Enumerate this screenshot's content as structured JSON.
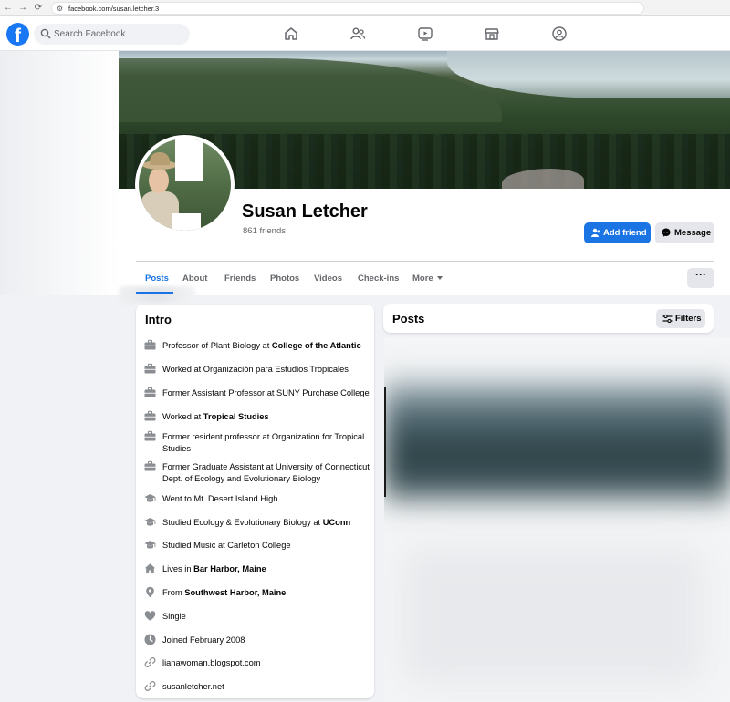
{
  "browser": {
    "back": "←",
    "forward": "→",
    "reload": "⟳",
    "site_settings": "⚙",
    "url": "facebook.com/susan.letcher.3"
  },
  "header": {
    "logo": "f",
    "search_placeholder": "Search Facebook"
  },
  "profile": {
    "name": "Susan Letcher",
    "friends": "861 friends",
    "add_friend_label": "Add friend",
    "message_label": "Message",
    "more_options_label": "···"
  },
  "tabs": [
    {
      "label": "Posts"
    },
    {
      "label": "About"
    },
    {
      "label": "Friends"
    },
    {
      "label": "Photos"
    },
    {
      "label": "Videos"
    },
    {
      "label": "Check-ins"
    },
    {
      "label": "More"
    }
  ],
  "intro": {
    "title": "Intro",
    "items": [
      {
        "icon": "briefcase-icon",
        "text": "Professor of Plant Biology at ",
        "bold": "College of the Atlantic"
      },
      {
        "icon": "briefcase-icon",
        "text": "Worked at Organización para Estudios Tropicales",
        "bold": ""
      },
      {
        "icon": "briefcase-icon",
        "text": "Former Assistant Professor at SUNY Purchase College",
        "bold": ""
      },
      {
        "icon": "briefcase-icon",
        "text": "Worked at ",
        "bold": "Tropical Studies"
      },
      {
        "icon": "briefcase-icon",
        "text": "Former resident professor at Organization for Tropical Studies",
        "bold": ""
      },
      {
        "icon": "briefcase-icon",
        "text": "Former Graduate Assistant at University of Connecticut Dept. of Ecology and Evolutionary Biology",
        "bold": ""
      },
      {
        "icon": "graduation-cap-icon",
        "text": "Went to Mt. Desert Island High",
        "bold": ""
      },
      {
        "icon": "graduation-cap-icon",
        "text": "Studied Ecology & Evolutionary Biology at ",
        "bold": "UConn"
      },
      {
        "icon": "graduation-cap-icon",
        "text": "Studied Music at Carleton College",
        "bold": ""
      },
      {
        "icon": "home-icon",
        "text": "Lives in ",
        "bold": "Bar Harbor, Maine"
      },
      {
        "icon": "location-pin-icon",
        "text": "From ",
        "bold": "Southwest Harbor, Maine"
      },
      {
        "icon": "heart-icon",
        "text": "Single",
        "bold": ""
      },
      {
        "icon": "clock-icon",
        "text": "Joined February 2008",
        "bold": ""
      },
      {
        "icon": "link-icon",
        "text": "lianawoman.blogspot.com",
        "bold": ""
      },
      {
        "icon": "link-icon",
        "text": "susanletcher.net",
        "bold": ""
      }
    ]
  },
  "posts": {
    "title": "Posts",
    "filters_label": "Filters"
  },
  "colors": {
    "brand_blue": "#1877f2",
    "button_blue": "#1b74e4",
    "secondary_gray": "#e4e6eb",
    "page_bg": "#f0f2f5",
    "icon_gray": "#65676b"
  }
}
